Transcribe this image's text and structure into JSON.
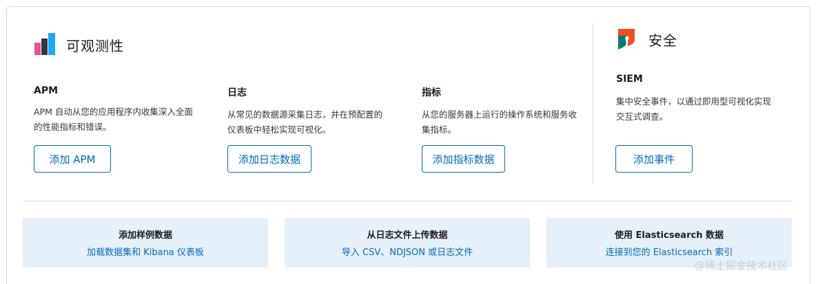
{
  "observability": {
    "title": "可观测性",
    "columns": [
      {
        "heading": "APM",
        "description": "APM 自动从您的应用程序内收集深入全面的性能指标和错误。",
        "button": "添加 APM"
      },
      {
        "heading": "日志",
        "description": "从常见的数据源采集日志，并在预配置的仪表板中轻松实现可视化。",
        "button": "添加日志数据"
      },
      {
        "heading": "指标",
        "description": "从您的服务器上运行的操作系统和服务收集指标。",
        "button": "添加指标数据"
      }
    ]
  },
  "security": {
    "title": "安全",
    "heading": "SIEM",
    "description": "集中安全事件，以通过即用型可视化实现交互式调查。",
    "button": "添加事件"
  },
  "cards": [
    {
      "title": "添加样例数据",
      "subtitle": "加载数据集和 Kibana 仪表板"
    },
    {
      "title": "从日志文件上传数据",
      "subtitle": "导入 CSV、NDJSON 或日志文件"
    },
    {
      "title": "使用 Elasticsearch 数据",
      "subtitle": "连接到您的 Elasticsearch 索引"
    }
  ],
  "watermark": "@稀土掘金技术社区",
  "colors": {
    "accent": "#006bb8",
    "card_bg": "#e6f0f8",
    "border": "#d3dae6"
  }
}
